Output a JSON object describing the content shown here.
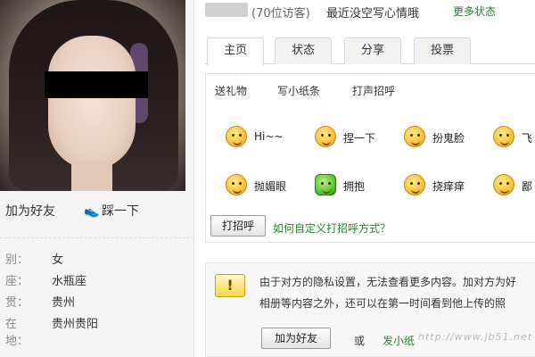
{
  "header": {
    "visitors": "(70位访客)",
    "status": "最近没空写心情哦",
    "more_status": "更多状态"
  },
  "profile": {
    "add_friend": "加为好友",
    "poke": "踩一下",
    "info": [
      {
        "key": "别：",
        "value": "女"
      },
      {
        "key": "座：",
        "value": "水瓶座"
      },
      {
        "key": "贯：",
        "value": "贵州"
      },
      {
        "key": "在 地：",
        "value": "贵州贵阳"
      }
    ]
  },
  "tabs": [
    "主页",
    "状态",
    "分享",
    "投票"
  ],
  "panel": {
    "links": [
      "送礼物",
      "写小纸条",
      "打声招呼"
    ],
    "greetings": [
      "Hi~~",
      "捏一下",
      "扮鬼脸",
      "飞",
      "抛媚眼",
      "拥抱",
      "挠痒痒",
      "鄙"
    ],
    "greet_button": "打招呼",
    "custom_link": "如何自定义打招呼方式？"
  },
  "notice": {
    "icon": "!",
    "line1": "由于对方的隐私设置，无法查看更多内容。加对方为好",
    "line2": "相册等内容之外，还可以在第一时间看到他上传的照",
    "add_button": "加为好友",
    "or": "或",
    "link": "发小纸",
    "watermark": "http://www.jb51.net"
  }
}
